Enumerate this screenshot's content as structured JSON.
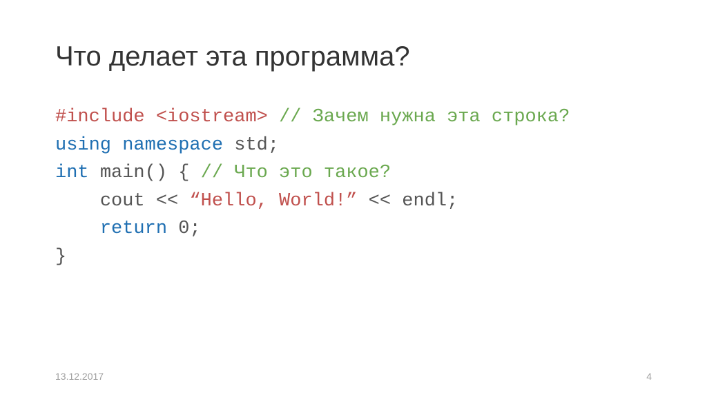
{
  "title": "Что делает эта программа?",
  "code": {
    "line1": {
      "preproc": "#include ",
      "include": "<iostream>",
      "space": " ",
      "comment": "// Зачем нужна эта строка?"
    },
    "line2": {
      "kw1": "using ",
      "kw2": "namespace ",
      "ident": "std",
      "semi": ";"
    },
    "line3": "",
    "line4": {
      "kw": "int ",
      "ident": "main",
      "parens": "() { ",
      "comment": "// Что это такое?"
    },
    "line5": {
      "indent": "    ",
      "ident1": "cout",
      "op1": " << ",
      "str": "“Hello, World!”",
      "op2": " << ",
      "ident2": "endl",
      "semi": ";"
    },
    "line6": {
      "indent": "    ",
      "kw": "return ",
      "val": "0",
      "semi": ";"
    },
    "line7": "}"
  },
  "footer": {
    "date": "13.12.2017",
    "page": "4"
  }
}
